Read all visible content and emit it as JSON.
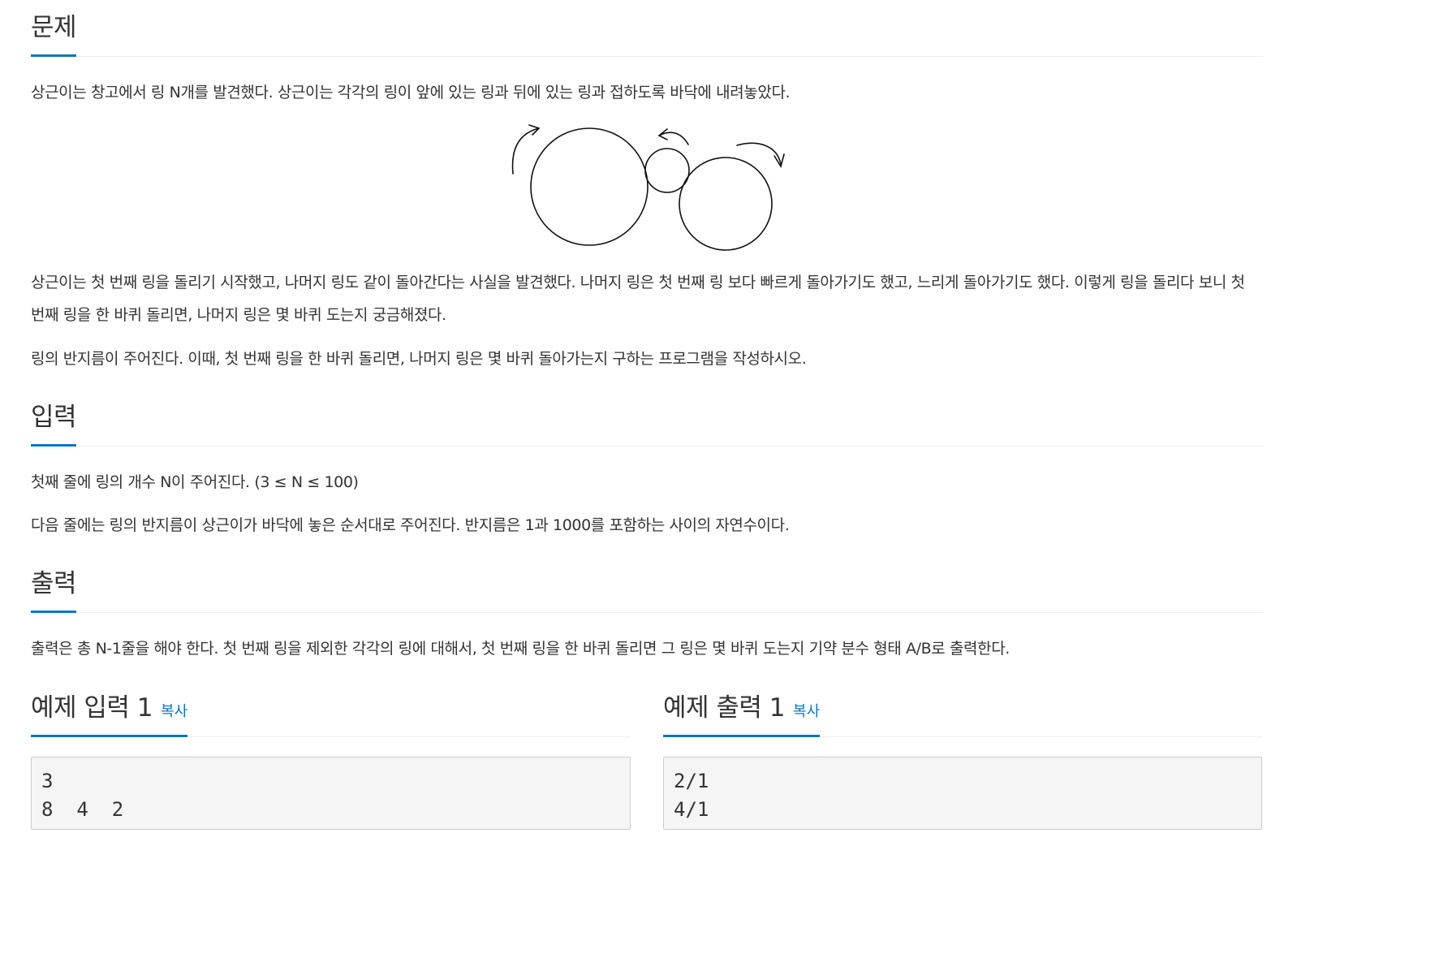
{
  "problem": {
    "heading": "문제",
    "para1": "상근이는 창고에서 링 N개를 발견했다. 상근이는 각각의 링이 앞에 있는 링과 뒤에 있는 링과 접하도록 바닥에 내려놓았다.",
    "para2": "상근이는 첫 번째 링을 돌리기 시작했고, 나머지 링도 같이 돌아간다는 사실을 발견했다. 나머지 링은 첫 번째 링 보다 빠르게 돌아가기도 했고, 느리게 돌아가기도 했다. 이렇게 링을 돌리다 보니 첫 번째 링을 한 바퀴 돌리면, 나머지 링은 몇 바퀴 도는지 궁금해졌다.",
    "para3": "링의 반지름이 주어진다. 이때, 첫 번째 링을 한 바퀴 돌리면, 나머지 링은 몇 바퀴 돌아가는지 구하는 프로그램을 작성하시오."
  },
  "input": {
    "heading": "입력",
    "para1": "첫째 줄에 링의 개수 N이 주어진다. (3 ≤ N ≤ 100)",
    "para2": "다음 줄에는 링의 반지름이 상근이가 바닥에 놓은 순서대로 주어진다. 반지름은 1과 1000를 포함하는 사이의 자연수이다."
  },
  "output": {
    "heading": "출력",
    "para1": "출력은 총 N-1줄을 해야 한다. 첫 번째 링을 제외한 각각의 링에 대해서, 첫 번째 링을 한 바퀴 돌리면 그 링은 몇 바퀴 도는지 기약 분수 형태 A/B로 출력한다."
  },
  "sample_input": {
    "heading": "예제 입력 1",
    "copy_label": "복사",
    "content": "3\n8  4  2"
  },
  "sample_output": {
    "heading": "예제 출력 1",
    "copy_label": "복사",
    "content": "2/1\n4/1"
  }
}
